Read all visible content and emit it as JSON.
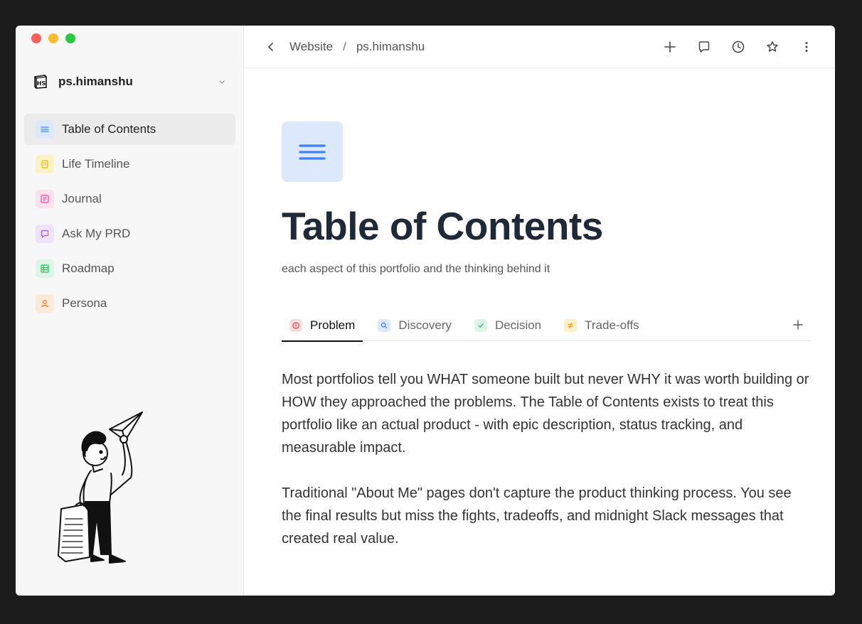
{
  "sidebar": {
    "workspace_name": "ps.himanshu",
    "items": [
      {
        "label": "Table of Contents",
        "icon": "list-icon",
        "color": "#3b82f6",
        "bg": "#dce8fc"
      },
      {
        "label": "Life Timeline",
        "icon": "document-icon",
        "color": "#eab308",
        "bg": "#fdf3c4"
      },
      {
        "label": "Journal",
        "icon": "note-icon",
        "color": "#ec4899",
        "bg": "#fbe1ee"
      },
      {
        "label": "Ask My PRD",
        "icon": "chat-icon",
        "color": "#a855f7",
        "bg": "#efe2fb"
      },
      {
        "label": "Roadmap",
        "icon": "grid-icon",
        "color": "#22c55e",
        "bg": "#dcf5e5"
      },
      {
        "label": "Persona",
        "icon": "user-icon",
        "color": "#f97316",
        "bg": "#fde9d8"
      }
    ]
  },
  "breadcrumb": {
    "parent": "Website",
    "separator": "/",
    "current": "ps.himanshu"
  },
  "page": {
    "title": "Table of Contents",
    "subtitle": "each aspect of this portfolio and the thinking behind it",
    "icon": "list-icon",
    "icon_color": "#3b82f6"
  },
  "tabs": [
    {
      "label": "Problem",
      "icon": "alert-icon",
      "color": "#ef4444",
      "bg": "#fde1e1"
    },
    {
      "label": "Discovery",
      "icon": "search-icon",
      "color": "#3b82f6",
      "bg": "#dce8fc"
    },
    {
      "label": "Decision",
      "icon": "check-icon",
      "color": "#22c55e",
      "bg": "#dcf5e5"
    },
    {
      "label": "Trade-offs",
      "icon": "not-equal-icon",
      "color": "#f59e0b",
      "bg": "#fdf0c8"
    }
  ],
  "body": {
    "p1": "Most portfolios tell you WHAT someone built but never WHY it was worth building or HOW they approached the problems. The Table of Contents exists to treat this portfolio like an actual product - with epic description, status tracking, and measurable impact.",
    "p2": "Traditional \"About Me\" pages don't capture the product thinking process. You see the final results but miss the fights, tradeoffs, and midnight Slack messages that created real value."
  }
}
